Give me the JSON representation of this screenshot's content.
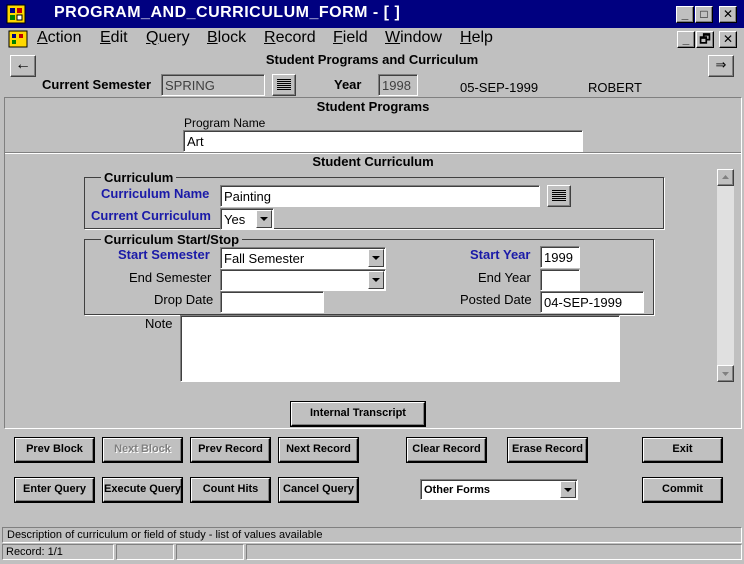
{
  "window": {
    "title": "PROGRAM_AND_CURRICULUM_FORM - [ ]",
    "minimize": "_",
    "maximize": "□",
    "close": "✕"
  },
  "menu": {
    "items": [
      {
        "key": "A",
        "rest": "ction"
      },
      {
        "key": "E",
        "rest": "dit"
      },
      {
        "key": "Q",
        "rest": "uery"
      },
      {
        "key": "B",
        "rest": "lock"
      },
      {
        "key": "R",
        "rest": "ecord"
      },
      {
        "key": "F",
        "rest": "ield"
      },
      {
        "key": "W",
        "rest": "indow"
      },
      {
        "key": "H",
        "rest": "elp"
      }
    ],
    "minimize": "_",
    "restore": "🗗",
    "close": "✕"
  },
  "header": {
    "form_title": "Student Programs and Curriculum",
    "current_semester_label": "Current Semester",
    "current_semester_value": "SPRING",
    "year_label": "Year",
    "year_value": "1998",
    "date": "05-SEP-1999",
    "user": "ROBERT",
    "back_arrow": "←",
    "forward_arrow": "⇒"
  },
  "student_programs": {
    "title": "Student Programs",
    "program_name_label": "Program Name",
    "program_name_value": "Art"
  },
  "student_curriculum": {
    "title": "Student Curriculum",
    "curriculum_group": "Curriculum",
    "curriculum_name_label": "Curriculum Name",
    "curriculum_name_value": "Painting",
    "current_curriculum_label": "Current Curriculum",
    "current_curriculum_value": "Yes",
    "startstop_group": "Curriculum Start/Stop",
    "start_semester_label": "Start Semester",
    "start_semester_value": "Fall Semester",
    "start_year_label": "Start Year",
    "start_year_value": "1999",
    "end_semester_label": "End Semester",
    "end_semester_value": "",
    "end_year_label": "End Year",
    "end_year_value": "",
    "drop_date_label": "Drop Date",
    "drop_date_value": "",
    "posted_date_label": "Posted Date",
    "posted_date_value": "04-SEP-1999",
    "note_label": "Note",
    "note_value": "",
    "internal_transcript": "Internal Transcript"
  },
  "buttons": {
    "prev_block": "Prev Block",
    "next_block": "Next Block",
    "prev_record": "Prev Record",
    "next_record": "Next Record",
    "clear_record": "Clear Record",
    "erase_record": "Erase Record",
    "exit": "Exit",
    "enter_query": "Enter Query",
    "execute_query": "Execute Query",
    "count_hits": "Count Hits",
    "cancel_query": "Cancel Query",
    "other_forms": "Other Forms",
    "commit": "Commit"
  },
  "status": {
    "message": "Description of curriculum or field of study - list of values available",
    "record": "Record: 1/1"
  }
}
